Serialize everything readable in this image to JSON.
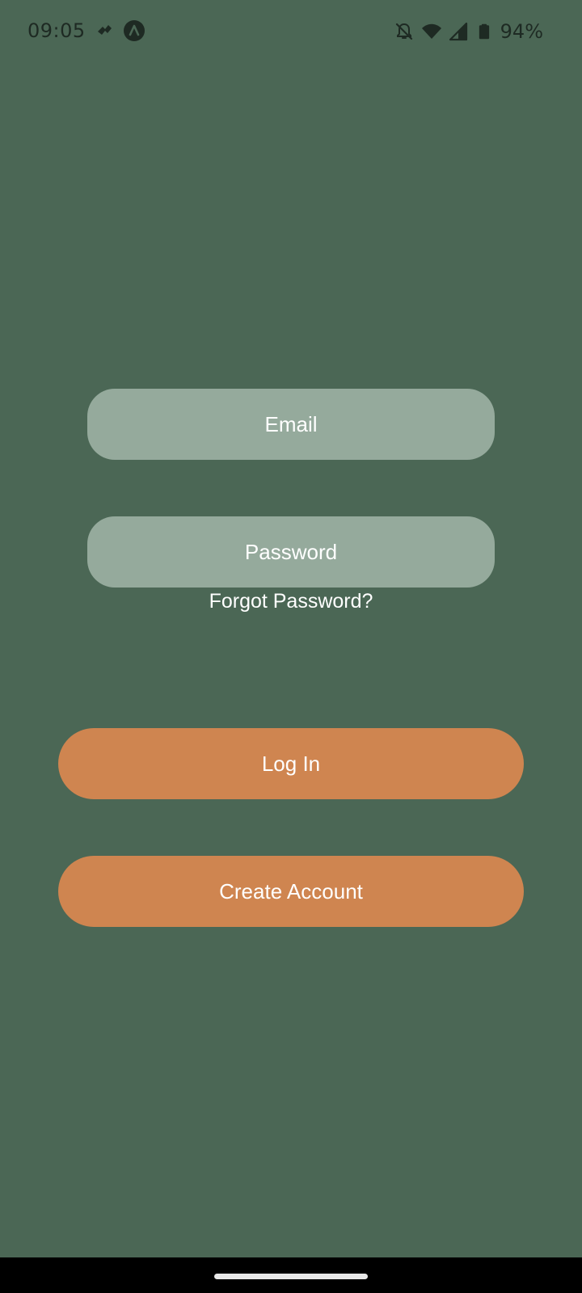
{
  "status_bar": {
    "time": "09:05",
    "left_icons": [
      "activity-app-icon",
      "navigation-app-icon"
    ],
    "right_icons": [
      "notifications-off-icon",
      "wifi-icon",
      "cellular-signal-icon",
      "battery-icon"
    ],
    "battery": "94%"
  },
  "login_form": {
    "email_placeholder": "Email",
    "email_value": "",
    "password_placeholder": "Password",
    "password_value": "",
    "forgot_password_label": "Forgot Password?",
    "login_label": "Log In",
    "create_account_label": "Create Account"
  },
  "colors": {
    "background": "#4b6755",
    "field": "#95aa9c",
    "button": "#cf8550",
    "text": "#ffffff"
  }
}
